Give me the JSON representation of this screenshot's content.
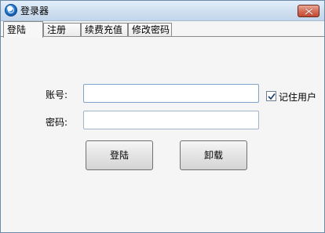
{
  "window": {
    "title": "登录器"
  },
  "tabs": [
    {
      "label": "登陆",
      "active": true
    },
    {
      "label": "注册",
      "active": false
    },
    {
      "label": "续费充值",
      "active": false
    },
    {
      "label": "修改密码",
      "active": false
    }
  ],
  "form": {
    "account_label": "账号:",
    "account_value": "",
    "password_label": "密码:",
    "password_value": "",
    "remember_label": "记住用户",
    "remember_checked": true
  },
  "buttons": {
    "login_label": "登陆",
    "uninstall_label": "卸载"
  }
}
